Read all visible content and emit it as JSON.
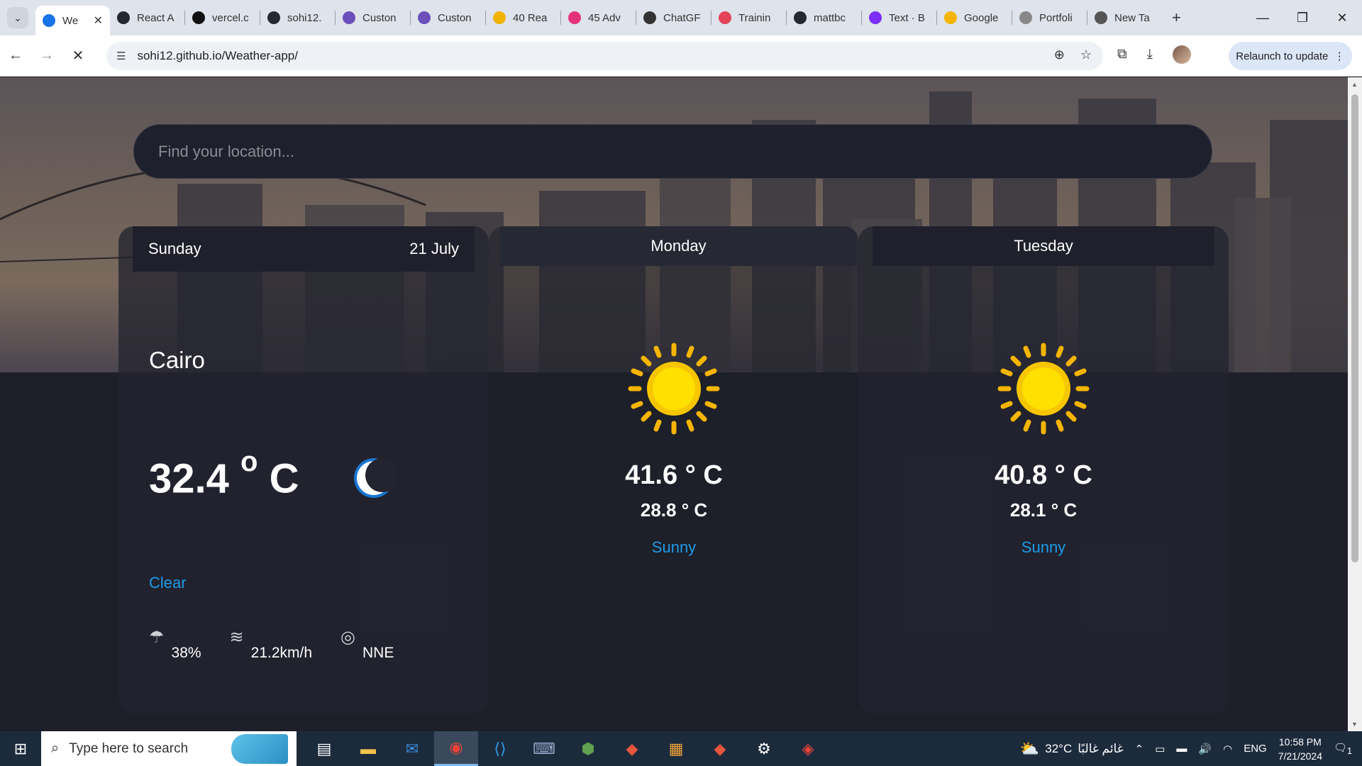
{
  "browser": {
    "tabs": [
      {
        "title": "We",
        "fav": "#1a73e8",
        "active": true
      },
      {
        "title": "React A",
        "fav": "#23272f"
      },
      {
        "title": "vercel.c",
        "fav": "#111"
      },
      {
        "title": "sohi12.",
        "fav": "#24292f"
      },
      {
        "title": "Custon",
        "fav": "#6b4fbb"
      },
      {
        "title": "Custon",
        "fav": "#6b4fbb"
      },
      {
        "title": "40 Rea",
        "fav": "#f0b400"
      },
      {
        "title": "45 Adv",
        "fav": "#e5337b"
      },
      {
        "title": "ChatGF",
        "fav": "#333"
      },
      {
        "title": "Trainin",
        "fav": "#e2455a"
      },
      {
        "title": "mattbc",
        "fav": "#24292f"
      },
      {
        "title": "Text · B",
        "fav": "#7b2ff7"
      },
      {
        "title": "Google",
        "fav": "#f4b400"
      },
      {
        "title": "Portfoli",
        "fav": "#888"
      },
      {
        "title": "New Ta",
        "fav": "#555"
      }
    ],
    "url": "sohi12.github.io/Weather-app/",
    "relaunch_label": "Relaunch to update"
  },
  "search": {
    "placeholder": "Find your location..."
  },
  "today": {
    "day": "Sunday",
    "date": "21 July",
    "city": "Cairo",
    "temp": "32.4",
    "unit_deg": "o",
    "unit_c": "C",
    "condition": "Clear",
    "humidity": "38%",
    "wind": "21.2km/h",
    "direction": "NNE"
  },
  "forecast": [
    {
      "day": "Monday",
      "max": "41.6 ° C",
      "min": "28.8 ° C",
      "condition": "Sunny"
    },
    {
      "day": "Tuesday",
      "max": "40.8 ° C",
      "min": "28.1 ° C",
      "condition": "Sunny"
    }
  ],
  "taskbar": {
    "search_placeholder": "Type here to search",
    "weather_temp": "32°C",
    "weather_text": "غائم غالبًا",
    "lang": "ENG",
    "time": "10:58 PM",
    "date": "7/21/2024",
    "notif_count": "1"
  },
  "colors": {
    "accent": "#1e9be9",
    "card": "#232430",
    "page_bg": "#1e1f29"
  }
}
